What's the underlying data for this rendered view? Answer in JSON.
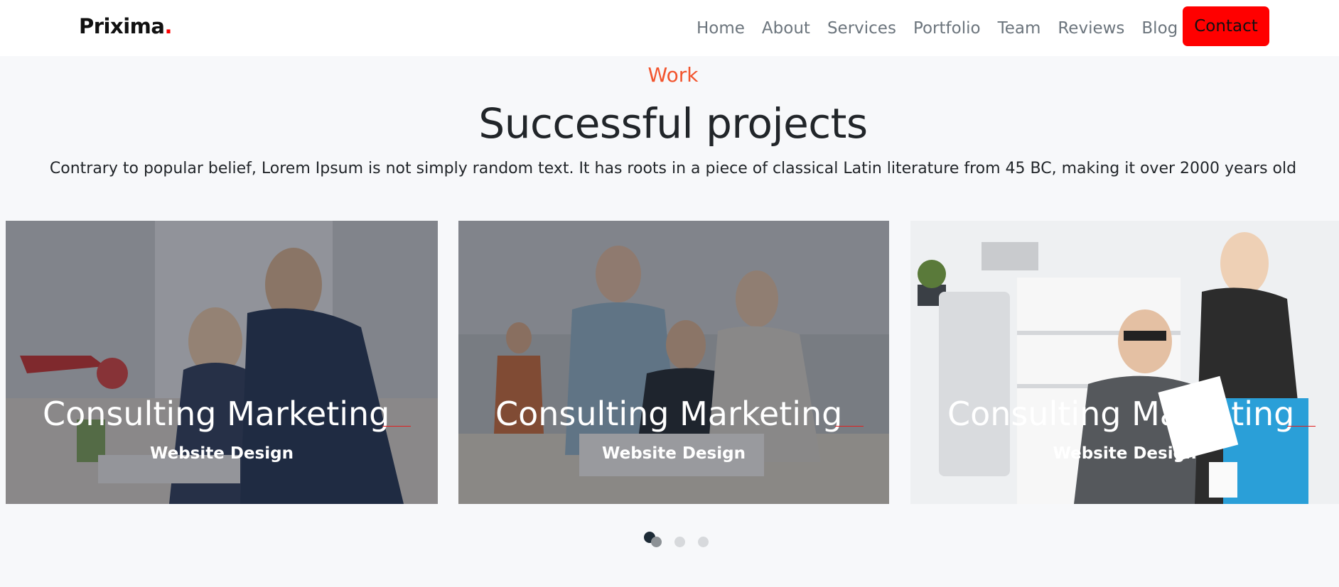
{
  "nav": {
    "brand": "Prixima",
    "brand_dot": ".",
    "links": [
      "Home",
      "About",
      "Services",
      "Portfolio",
      "Team",
      "Reviews",
      "Blog"
    ],
    "contact_label": "Contact"
  },
  "section": {
    "eyebrow": "Work",
    "heading": "Successful projects",
    "lead": "Contrary to popular belief, Lorem Ipsum is not simply random text. It has roots in a piece of classical Latin literature from 45 BC, making it over 2000 years old"
  },
  "cards": [
    {
      "title": "Consulting Marketing",
      "subtitle": "Website Design"
    },
    {
      "title": "Consulting Marketing",
      "subtitle": "Website Design"
    },
    {
      "title": "Consulting Marketing",
      "subtitle": "Website Design"
    }
  ],
  "pagination": {
    "pages": 3,
    "active": 1
  },
  "colors": {
    "accent": "#ff0000",
    "eyebrow": "#f2542d",
    "background": "#f7f8fa",
    "dot_active": "#1d2b36"
  }
}
